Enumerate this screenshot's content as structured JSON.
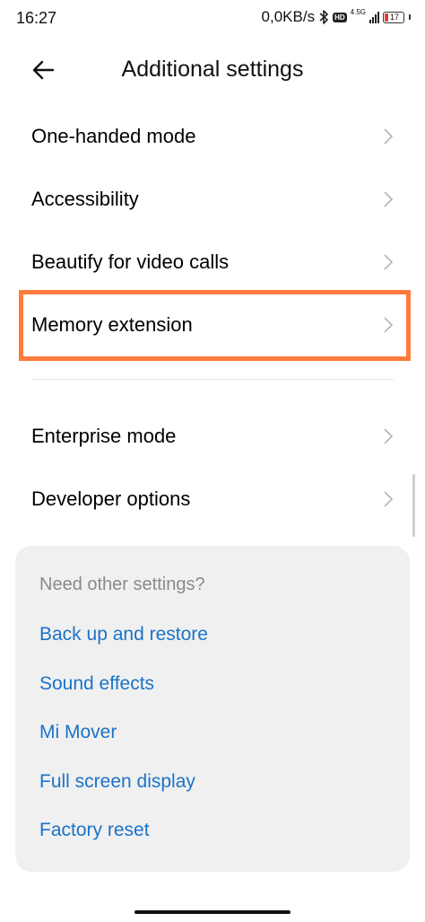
{
  "status": {
    "time": "16:27",
    "speed": "0,0KB/s",
    "hd_label": "HD",
    "network": "4.5G",
    "battery": "17"
  },
  "header": {
    "back_icon": "arrow-left-icon",
    "title": "Additional settings"
  },
  "settings": {
    "items": [
      {
        "label": "One-handed mode"
      },
      {
        "label": "Accessibility"
      },
      {
        "label": "Beautify for video calls"
      },
      {
        "label": "Memory extension"
      }
    ],
    "items2": [
      {
        "label": "Enterprise mode"
      },
      {
        "label": "Developer options"
      }
    ]
  },
  "other": {
    "title": "Need other settings?",
    "links": [
      {
        "label": "Back up and restore"
      },
      {
        "label": "Sound effects"
      },
      {
        "label": "Mi Mover"
      },
      {
        "label": "Full screen display"
      },
      {
        "label": "Factory reset"
      }
    ]
  },
  "colors": {
    "highlight": "#ff7a3d",
    "link": "#1a73c9",
    "battery_low": "#e53935"
  }
}
